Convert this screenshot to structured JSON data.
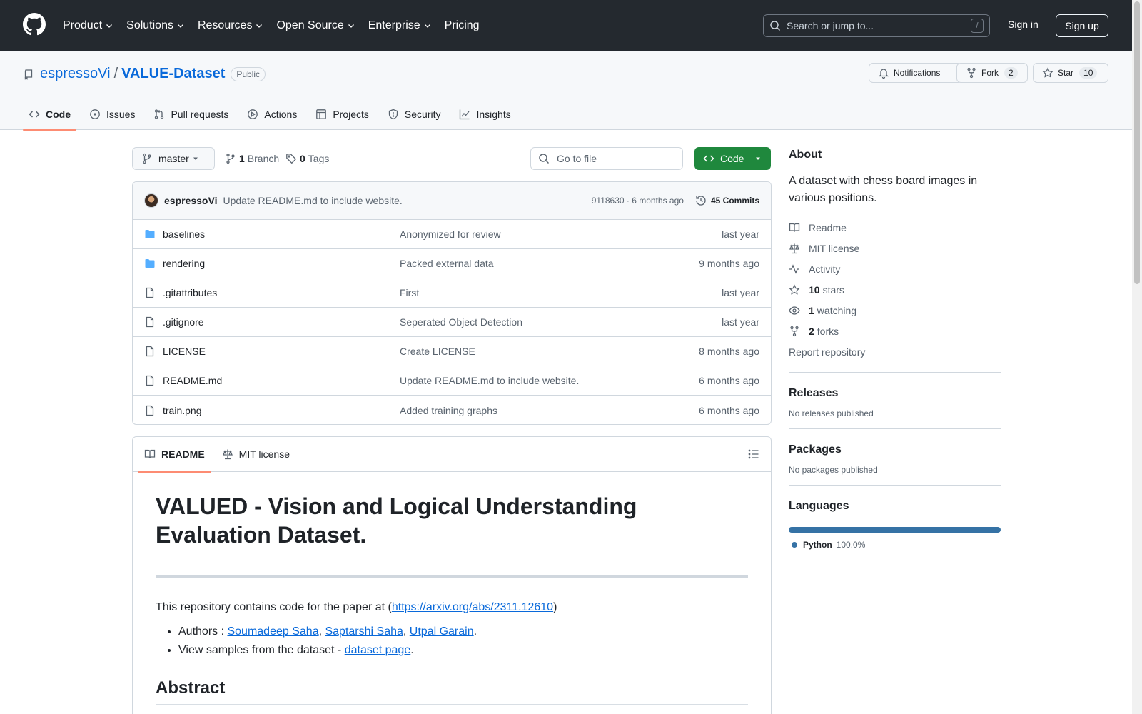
{
  "header": {
    "nav": [
      {
        "label": "Product",
        "dropdown": true
      },
      {
        "label": "Solutions",
        "dropdown": true
      },
      {
        "label": "Resources",
        "dropdown": true
      },
      {
        "label": "Open Source",
        "dropdown": true
      },
      {
        "label": "Enterprise",
        "dropdown": true
      },
      {
        "label": "Pricing",
        "dropdown": false
      }
    ],
    "search_placeholder": "Search or jump to...",
    "search_shortcut": "/",
    "signin": "Sign in",
    "signup": "Sign up"
  },
  "repo": {
    "owner": "espressoVi",
    "separator": "/",
    "name": "VALUE-Dataset",
    "visibility": "Public",
    "notifications_label": "Notifications",
    "fork_label": "Fork",
    "fork_count": "2",
    "star_label": "Star",
    "star_count": "10",
    "tabs": [
      {
        "label": "Code",
        "icon": "code-icon",
        "active": true
      },
      {
        "label": "Issues",
        "icon": "issue-icon",
        "active": false
      },
      {
        "label": "Pull requests",
        "icon": "pull-request-icon",
        "active": false
      },
      {
        "label": "Actions",
        "icon": "play-icon",
        "active": false
      },
      {
        "label": "Projects",
        "icon": "table-icon",
        "active": false
      },
      {
        "label": "Security",
        "icon": "shield-icon",
        "active": false
      },
      {
        "label": "Insights",
        "icon": "graph-icon",
        "active": false
      }
    ]
  },
  "toolbar": {
    "branch": "master",
    "branch_count": "1",
    "branch_label": "Branch",
    "tag_count": "0",
    "tag_label": "Tags",
    "goto_placeholder": "Go to file",
    "code_label": "Code"
  },
  "commit": {
    "author": "espressoVi",
    "message": "Update README.md to include website.",
    "hash_time": "9118630 · 6 months ago",
    "commits_label": "45 Commits"
  },
  "files": [
    {
      "name": "baselines",
      "type": "folder",
      "message": "Anonymized for review",
      "date": "last year"
    },
    {
      "name": "rendering",
      "type": "folder",
      "message": "Packed external data",
      "date": "9 months ago"
    },
    {
      "name": ".gitattributes",
      "type": "file",
      "message": "First",
      "date": "last year"
    },
    {
      "name": ".gitignore",
      "type": "file",
      "message": "Seperated Object Detection",
      "date": "last year"
    },
    {
      "name": "LICENSE",
      "type": "file",
      "message": "Create LICENSE",
      "date": "8 months ago"
    },
    {
      "name": "README.md",
      "type": "file",
      "message": "Update README.md to include website.",
      "date": "6 months ago"
    },
    {
      "name": "train.png",
      "type": "file",
      "message": "Added training graphs",
      "date": "6 months ago"
    }
  ],
  "readme": {
    "tab_readme": "README",
    "tab_license": "MIT license",
    "title_line1": "VALUED - Vision and Logical Understanding",
    "title_line2": "Evaluation Dataset.",
    "intro": "This repository contains code for the paper at (",
    "intro_link": "https://arxiv.org/abs/2311.12610",
    "intro_end": ")",
    "authors_prefix": "Authors : ",
    "author1": "Soumadeep Saha",
    "author2": "Saptarshi Saha",
    "author3": "Utpal Garain",
    "comma": ", ",
    "period": ".",
    "samples_prefix": "View samples from the dataset - ",
    "samples_link": "dataset page",
    "abstract": "Abstract"
  },
  "about": {
    "title": "About",
    "description": "A dataset with chess board images in various positions.",
    "readme": "Readme",
    "license": "MIT license",
    "activity": "Activity",
    "stars_count": "10",
    "stars_label": "stars",
    "watching_count": "1",
    "watching_label": "watching",
    "forks_count": "2",
    "forks_label": "forks",
    "report": "Report repository"
  },
  "releases": {
    "title": "Releases",
    "empty": "No releases published"
  },
  "packages": {
    "title": "Packages",
    "empty": "No packages published"
  },
  "languages": {
    "title": "Languages",
    "name": "Python",
    "percent": "100.0%",
    "color": "#3572a5"
  }
}
